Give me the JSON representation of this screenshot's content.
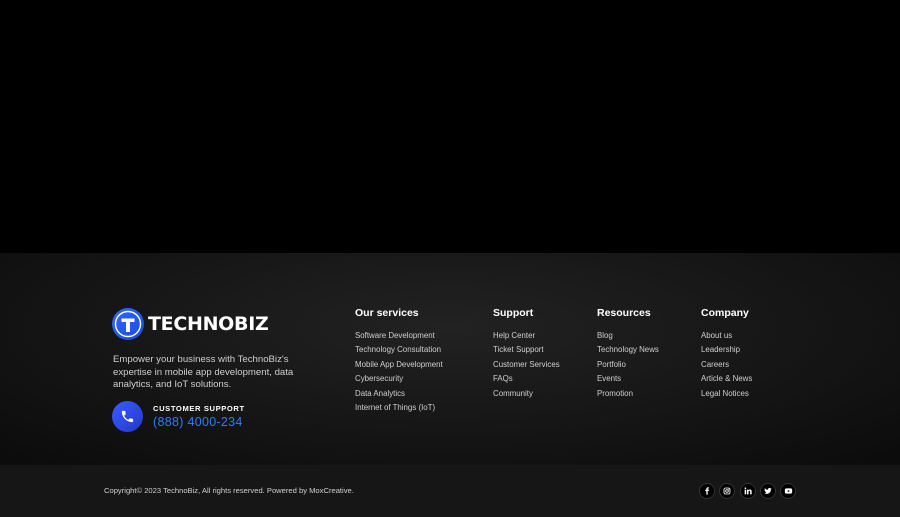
{
  "brand": {
    "name": "TECHNOBIZ",
    "tagline": "Empower your business with TechnoBiz's expertise in mobile app development, data analytics, and IoT solutions.",
    "accent_color": "#2f7bff"
  },
  "support": {
    "label": "CUSTOMER SUPPORT",
    "phone": "(888) 4000-234",
    "icon": "phone-icon"
  },
  "columns": [
    {
      "title": "Our services",
      "links": [
        "Software Development",
        "Technology Consultation",
        "Mobile App Development",
        "Cybersecurity",
        "Data Analytics",
        "Internet of Things (IoT)"
      ]
    },
    {
      "title": "Support",
      "links": [
        "Help Center",
        "Ticket Support",
        "Customer Services",
        "FAQs",
        "Community"
      ]
    },
    {
      "title": "Resources",
      "links": [
        "Blog",
        "Technology News",
        "Portfolio",
        "Events",
        "Promotion"
      ]
    },
    {
      "title": "Company",
      "links": [
        "About us",
        "Leadership",
        "Careers",
        "Article & News",
        "Legal Notices"
      ]
    }
  ],
  "bottom": {
    "copyright": "Copyright© 2023 TechnoBiz, All rights reserved. Powered by MoxCreative.",
    "socials": [
      "facebook-icon",
      "instagram-icon",
      "linkedin-icon",
      "twitter-icon",
      "youtube-icon"
    ]
  }
}
